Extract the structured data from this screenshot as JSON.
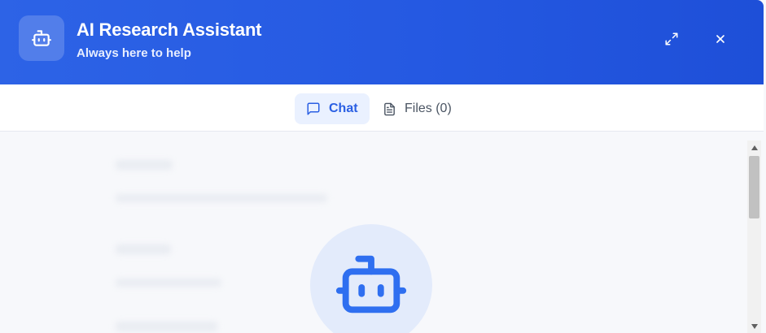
{
  "header": {
    "title": "AI Research Assistant",
    "subtitle": "Always here to help",
    "icon": "robot-icon",
    "expand_icon": "expand-icon",
    "close_icon": "close-icon",
    "color": "#2559e2"
  },
  "tabs": [
    {
      "label": "Chat",
      "icon": "chat-bubble-icon",
      "active": true
    },
    {
      "label": "Files (0)",
      "icon": "document-icon",
      "active": false
    }
  ],
  "content": {
    "avatar_icon": "robot-icon",
    "accent_color": "#2f6ff0"
  },
  "scrollbar": {
    "up_icon": "scroll-up-arrow-icon",
    "down_icon": "scroll-down-arrow-icon"
  }
}
